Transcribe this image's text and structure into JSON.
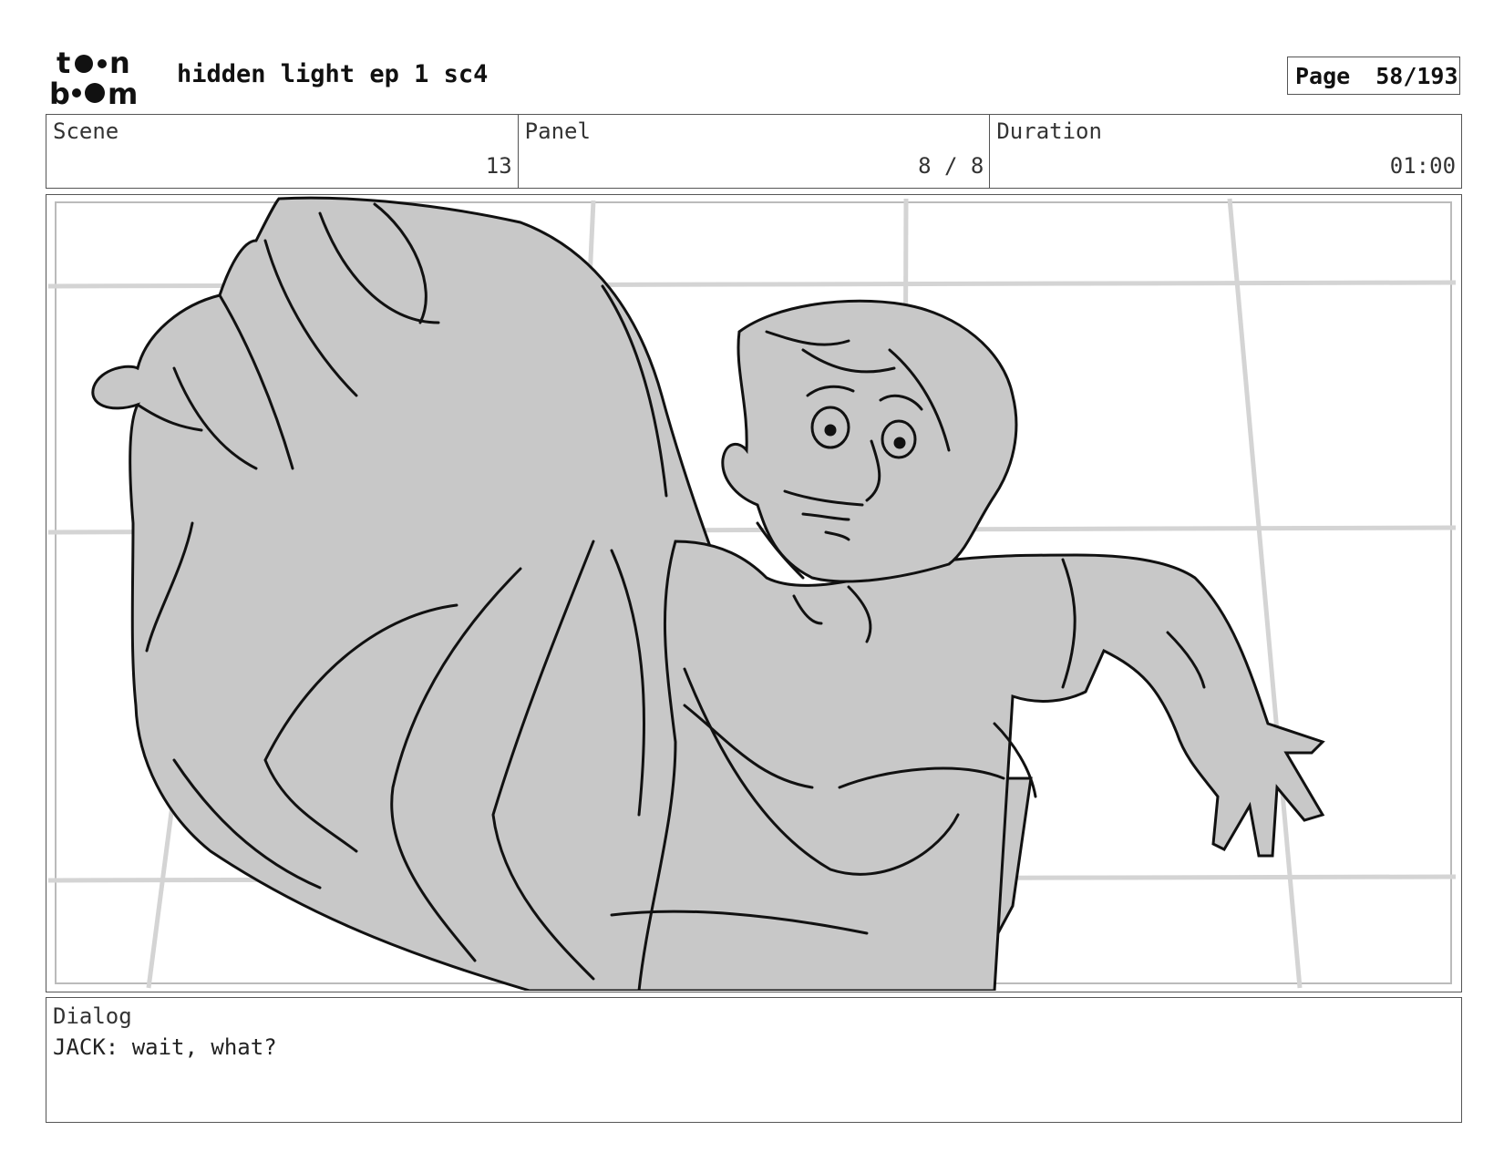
{
  "header": {
    "logo_text": "toon boom",
    "title": "hidden light ep 1 sc4",
    "page_label": "Page",
    "page_value": "58/193"
  },
  "info": {
    "scene_label": "Scene",
    "scene_value": "13",
    "panel_label": "Panel",
    "panel_value": "8 / 8",
    "duration_label": "Duration",
    "duration_value": "01:00"
  },
  "dialog": {
    "label": "Dialog",
    "text": "JACK: wait, what?"
  },
  "colors": {
    "fill_gray": "#c8c8c8",
    "line": "#111111",
    "grid": "#d4d4d4"
  }
}
